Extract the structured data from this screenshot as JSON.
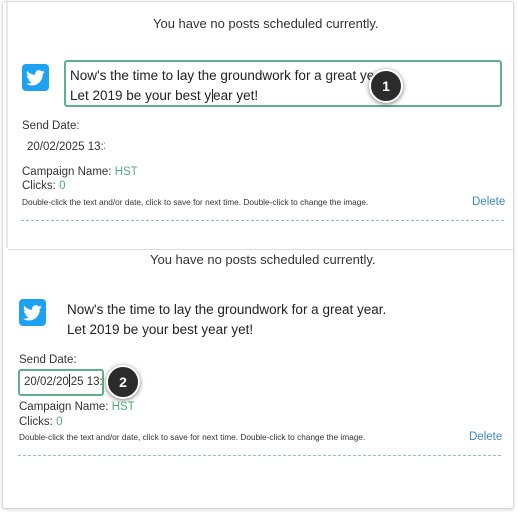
{
  "posts": [
    {
      "empty_message": "You have no posts scheduled currently.",
      "icon": "twitter-bird-icon",
      "text_line1": "Now's the time to lay the groundwork for a great year.",
      "text_line2_pre": "Let 2019 be your best y",
      "text_line2_post": "ear yet!",
      "send_date_label": "Send Date:",
      "send_date_value": "20/02/2025 13:3",
      "campaign_label": "Campaign Name:",
      "campaign_value": "HST",
      "clicks_label": "Clicks:",
      "clicks_value": "0",
      "help_text": "Double-click the text and/or date, click to save for next time. Double-click to change the image.",
      "delete_label": "Delete",
      "badge": "1"
    },
    {
      "empty_message": "You have no posts scheduled currently.",
      "icon": "twitter-bird-icon",
      "text_line1": "Now's the time to lay the groundwork for a great year.",
      "text_line2": "Let 2019 be your best year yet!",
      "send_date_label": "Send Date:",
      "send_date_pre": "20/02/20",
      "send_date_post": "25 13:3",
      "campaign_label": "Campaign Name:",
      "campaign_value": "HST",
      "clicks_label": "Clicks:",
      "clicks_value": "0",
      "help_text": "Double-click the text and/or date, click to save for next time. Double-click to change the image.",
      "delete_label": "Delete",
      "badge": "2"
    }
  ],
  "colors": {
    "twitter_blue": "#1da1f2",
    "edit_border": "#5cb389",
    "link_blue": "#3a87c7",
    "badge_bg": "#2b2b2b"
  }
}
